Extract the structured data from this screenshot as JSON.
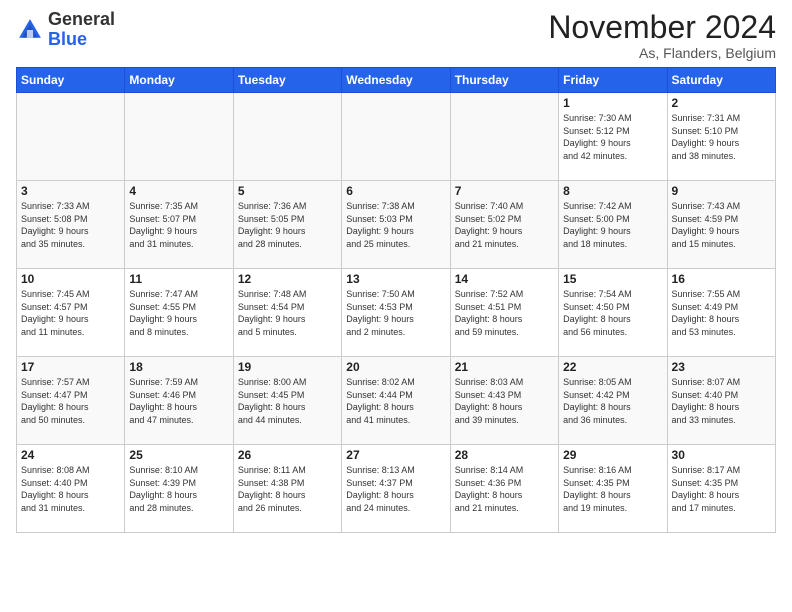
{
  "logo": {
    "text_general": "General",
    "text_blue": "Blue"
  },
  "header": {
    "month_title": "November 2024",
    "location": "As, Flanders, Belgium"
  },
  "days_of_week": [
    "Sunday",
    "Monday",
    "Tuesday",
    "Wednesday",
    "Thursday",
    "Friday",
    "Saturday"
  ],
  "weeks": [
    [
      {
        "day": "",
        "info": ""
      },
      {
        "day": "",
        "info": ""
      },
      {
        "day": "",
        "info": ""
      },
      {
        "day": "",
        "info": ""
      },
      {
        "day": "",
        "info": ""
      },
      {
        "day": "1",
        "info": "Sunrise: 7:30 AM\nSunset: 5:12 PM\nDaylight: 9 hours\nand 42 minutes."
      },
      {
        "day": "2",
        "info": "Sunrise: 7:31 AM\nSunset: 5:10 PM\nDaylight: 9 hours\nand 38 minutes."
      }
    ],
    [
      {
        "day": "3",
        "info": "Sunrise: 7:33 AM\nSunset: 5:08 PM\nDaylight: 9 hours\nand 35 minutes."
      },
      {
        "day": "4",
        "info": "Sunrise: 7:35 AM\nSunset: 5:07 PM\nDaylight: 9 hours\nand 31 minutes."
      },
      {
        "day": "5",
        "info": "Sunrise: 7:36 AM\nSunset: 5:05 PM\nDaylight: 9 hours\nand 28 minutes."
      },
      {
        "day": "6",
        "info": "Sunrise: 7:38 AM\nSunset: 5:03 PM\nDaylight: 9 hours\nand 25 minutes."
      },
      {
        "day": "7",
        "info": "Sunrise: 7:40 AM\nSunset: 5:02 PM\nDaylight: 9 hours\nand 21 minutes."
      },
      {
        "day": "8",
        "info": "Sunrise: 7:42 AM\nSunset: 5:00 PM\nDaylight: 9 hours\nand 18 minutes."
      },
      {
        "day": "9",
        "info": "Sunrise: 7:43 AM\nSunset: 4:59 PM\nDaylight: 9 hours\nand 15 minutes."
      }
    ],
    [
      {
        "day": "10",
        "info": "Sunrise: 7:45 AM\nSunset: 4:57 PM\nDaylight: 9 hours\nand 11 minutes."
      },
      {
        "day": "11",
        "info": "Sunrise: 7:47 AM\nSunset: 4:55 PM\nDaylight: 9 hours\nand 8 minutes."
      },
      {
        "day": "12",
        "info": "Sunrise: 7:48 AM\nSunset: 4:54 PM\nDaylight: 9 hours\nand 5 minutes."
      },
      {
        "day": "13",
        "info": "Sunrise: 7:50 AM\nSunset: 4:53 PM\nDaylight: 9 hours\nand 2 minutes."
      },
      {
        "day": "14",
        "info": "Sunrise: 7:52 AM\nSunset: 4:51 PM\nDaylight: 8 hours\nand 59 minutes."
      },
      {
        "day": "15",
        "info": "Sunrise: 7:54 AM\nSunset: 4:50 PM\nDaylight: 8 hours\nand 56 minutes."
      },
      {
        "day": "16",
        "info": "Sunrise: 7:55 AM\nSunset: 4:49 PM\nDaylight: 8 hours\nand 53 minutes."
      }
    ],
    [
      {
        "day": "17",
        "info": "Sunrise: 7:57 AM\nSunset: 4:47 PM\nDaylight: 8 hours\nand 50 minutes."
      },
      {
        "day": "18",
        "info": "Sunrise: 7:59 AM\nSunset: 4:46 PM\nDaylight: 8 hours\nand 47 minutes."
      },
      {
        "day": "19",
        "info": "Sunrise: 8:00 AM\nSunset: 4:45 PM\nDaylight: 8 hours\nand 44 minutes."
      },
      {
        "day": "20",
        "info": "Sunrise: 8:02 AM\nSunset: 4:44 PM\nDaylight: 8 hours\nand 41 minutes."
      },
      {
        "day": "21",
        "info": "Sunrise: 8:03 AM\nSunset: 4:43 PM\nDaylight: 8 hours\nand 39 minutes."
      },
      {
        "day": "22",
        "info": "Sunrise: 8:05 AM\nSunset: 4:42 PM\nDaylight: 8 hours\nand 36 minutes."
      },
      {
        "day": "23",
        "info": "Sunrise: 8:07 AM\nSunset: 4:40 PM\nDaylight: 8 hours\nand 33 minutes."
      }
    ],
    [
      {
        "day": "24",
        "info": "Sunrise: 8:08 AM\nSunset: 4:40 PM\nDaylight: 8 hours\nand 31 minutes."
      },
      {
        "day": "25",
        "info": "Sunrise: 8:10 AM\nSunset: 4:39 PM\nDaylight: 8 hours\nand 28 minutes."
      },
      {
        "day": "26",
        "info": "Sunrise: 8:11 AM\nSunset: 4:38 PM\nDaylight: 8 hours\nand 26 minutes."
      },
      {
        "day": "27",
        "info": "Sunrise: 8:13 AM\nSunset: 4:37 PM\nDaylight: 8 hours\nand 24 minutes."
      },
      {
        "day": "28",
        "info": "Sunrise: 8:14 AM\nSunset: 4:36 PM\nDaylight: 8 hours\nand 21 minutes."
      },
      {
        "day": "29",
        "info": "Sunrise: 8:16 AM\nSunset: 4:35 PM\nDaylight: 8 hours\nand 19 minutes."
      },
      {
        "day": "30",
        "info": "Sunrise: 8:17 AM\nSunset: 4:35 PM\nDaylight: 8 hours\nand 17 minutes."
      }
    ]
  ]
}
